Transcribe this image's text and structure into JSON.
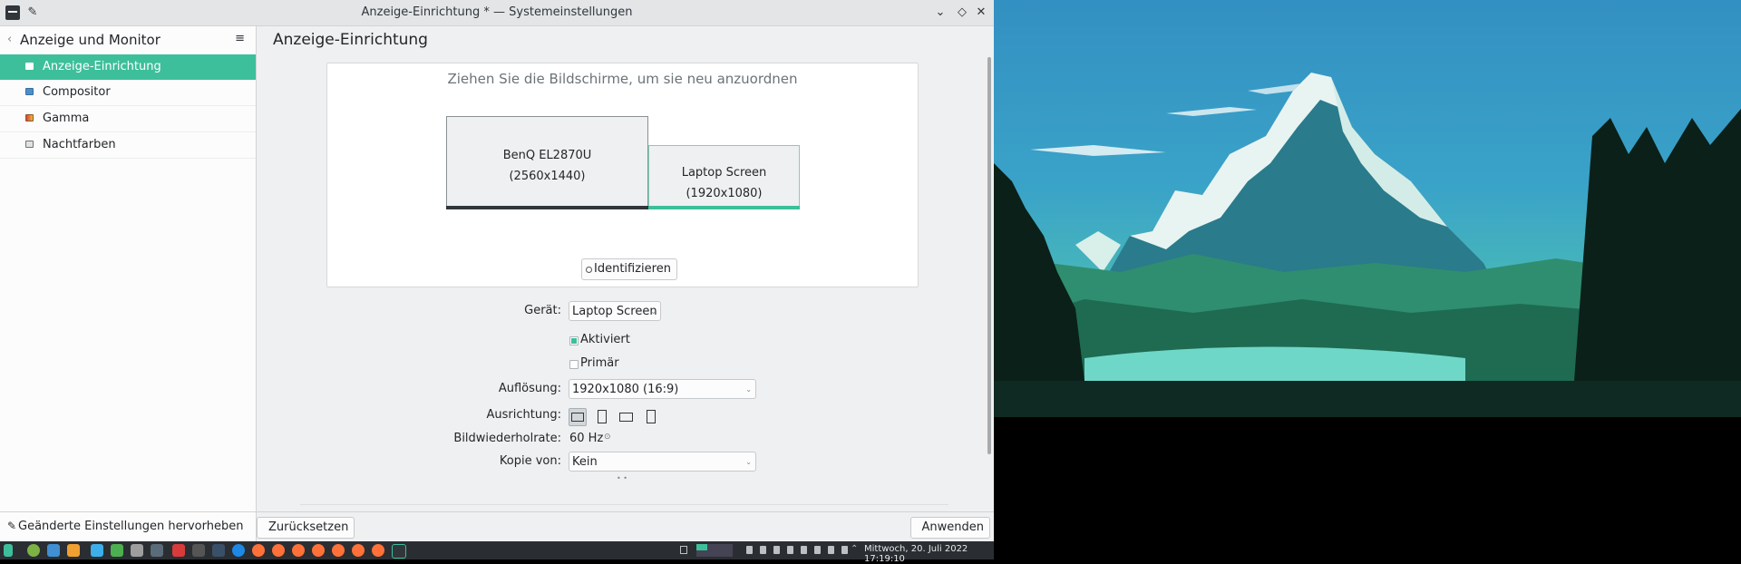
{
  "window": {
    "title": "Anzeige-Einrichtung * — Systemeinstellungen",
    "controls": [
      "chevron-down-icon",
      "diamond-icon",
      "close-icon"
    ],
    "pin_icon": "pin-icon"
  },
  "sidebar": {
    "back_glyph": "‹",
    "title": "Anzeige und Monitor",
    "menu_glyph": "≡",
    "items": [
      {
        "label": "Anzeige-Einrichtung",
        "active": true,
        "icon": "display-icon"
      },
      {
        "label": "Compositor",
        "active": false,
        "icon": "compositor-icon"
      },
      {
        "label": "Gamma",
        "active": false,
        "icon": "gamma-icon"
      },
      {
        "label": "Nachtfarben",
        "active": false,
        "icon": "night-color-icon"
      }
    ],
    "footer_button": "Geänderte Einstellungen hervorheben"
  },
  "main": {
    "title": "Anzeige-Einrichtung",
    "arrange_hint": "Ziehen Sie die Bildschirme, um sie neu anzuordnen",
    "screens": [
      {
        "name": "BenQ EL2870U",
        "resolution": "(2560x1440)",
        "selected": false,
        "bar_color": "#31363b"
      },
      {
        "name": "Laptop Screen",
        "resolution": "(1920x1080)",
        "selected": true,
        "bar_color": "#3dbf9b"
      }
    ],
    "identify_button": "Identifizieren",
    "form": {
      "device_label": "Gerät:",
      "device_value": "Laptop Screen",
      "enabled_label": "Aktiviert",
      "enabled_checked": true,
      "primary_label": "Primär",
      "primary_checked": false,
      "resolution_label": "Auflösung:",
      "resolution_value": "1920x1080 (16:9)",
      "orientation_label": "Ausrichtung:",
      "orientation_options": [
        "orientation-landscape-icon",
        "orientation-portrait-icon",
        "orientation-landscape-flipped-icon",
        "orientation-portrait-flipped-icon"
      ],
      "orientation_selected": 0,
      "refresh_label": "Bildwiederholrate:",
      "refresh_value": "60 Hz",
      "mirror_label": "Kopie von:",
      "mirror_value": "Kein"
    },
    "reset_button": "Zurücksetzen",
    "apply_button": "Anwenden"
  },
  "taskbar": {
    "clock": "Mittwoch, 20. Juli 2022   17:19:10"
  },
  "colors": {
    "accent": "#3dbf9b",
    "window_bg": "#eff0f1",
    "taskbar_bg": "#2a2e32",
    "sky_top": "#2f8fc0",
    "snow": "#e8f4f2",
    "forest": "#0f2a22",
    "lake": "#5fd3c4"
  }
}
